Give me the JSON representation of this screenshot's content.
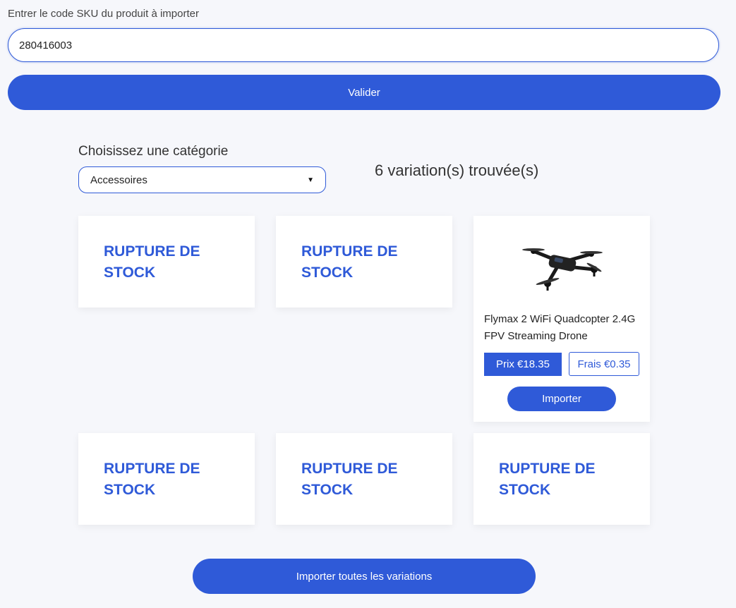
{
  "sku": {
    "label": "Entrer le code SKU du produit à importer",
    "value": "280416003"
  },
  "validate_label": "Valider",
  "category": {
    "label": "Choisissez une catégorie",
    "selected": "Accessoires"
  },
  "variations_found": "6 variation(s) trouvée(s)",
  "cards": [
    {
      "status": "RUPTURE DE STOCK"
    },
    {
      "status": "RUPTURE DE STOCK"
    },
    {
      "title": "Flymax 2 WiFi Quadcopter 2.4G FPV Streaming Drone",
      "price": "Prix €18.35",
      "fee": "Frais €0.35",
      "import_label": "Importer"
    },
    {
      "status": "RUPTURE DE STOCK"
    },
    {
      "status": "RUPTURE DE STOCK"
    },
    {
      "status": "RUPTURE DE STOCK"
    }
  ],
  "import_all_label": "Importer toutes les variations",
  "colors": {
    "accent": "#2f5ad8",
    "background": "#f6f7fb"
  }
}
